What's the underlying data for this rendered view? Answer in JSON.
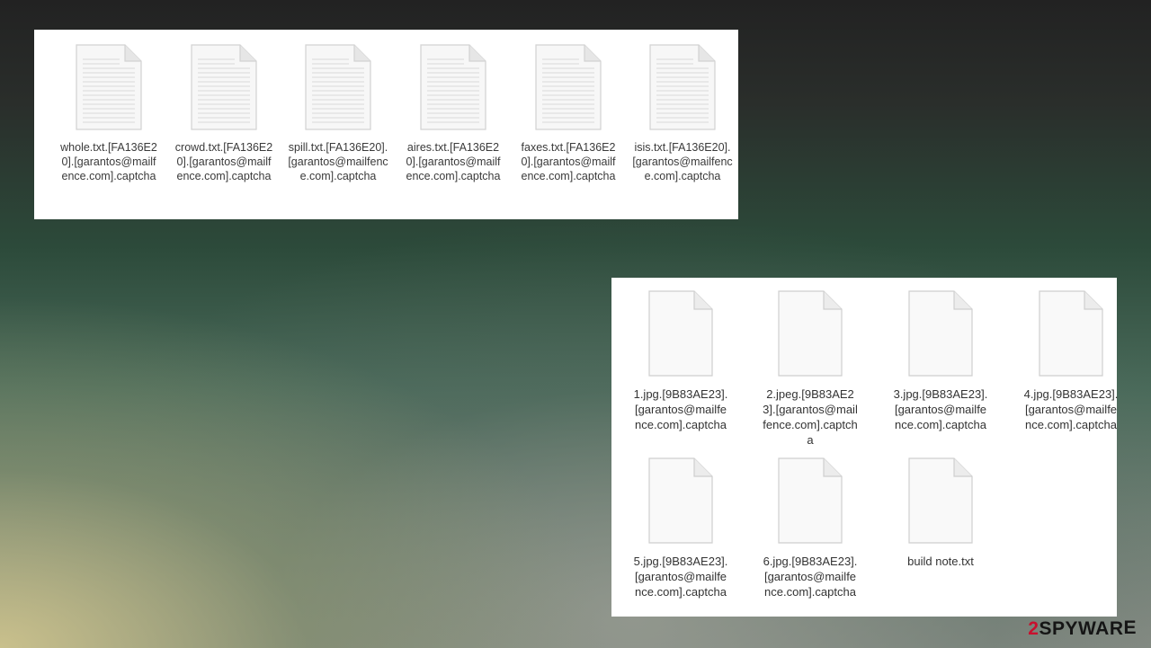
{
  "top_files": [
    {
      "name": "whole.txt.[FA136E20].[garantos@mailfence.com].captcha",
      "icon": "text-document-icon"
    },
    {
      "name": "crowd.txt.[FA136E20].[garantos@mailfence.com].captcha",
      "icon": "text-document-icon"
    },
    {
      "name": "spill.txt.[FA136E20].[garantos@mailfence.com].captcha",
      "icon": "text-document-icon"
    },
    {
      "name": "aires.txt.[FA136E20].[garantos@mailfence.com].captcha",
      "icon": "text-document-icon"
    },
    {
      "name": "faxes.txt.[FA136E20].[garantos@mailfence.com].captcha",
      "icon": "text-document-icon"
    },
    {
      "name": "isis.txt.[FA136E20].[garantos@mailfence.com].captcha",
      "icon": "text-document-icon"
    }
  ],
  "bottom_files": [
    {
      "name": "1.jpg.[9B83AE23].[garantos@mailfence.com].captcha",
      "icon": "blank-file-icon"
    },
    {
      "name": "2.jpeg.[9B83AE23].[garantos@mailfence.com].captcha",
      "icon": "blank-file-icon"
    },
    {
      "name": "3.jpg.[9B83AE23].[garantos@mailfence.com].captcha",
      "icon": "blank-file-icon"
    },
    {
      "name": "4.jpg.[9B83AE23].[garantos@mailfence.com].captcha",
      "icon": "blank-file-icon"
    },
    {
      "name": "5.jpg.[9B83AE23].[garantos@mailfence.com].captcha",
      "icon": "blank-file-icon"
    },
    {
      "name": "6.jpg.[9B83AE23].[garantos@mailfence.com].captcha",
      "icon": "blank-file-icon"
    },
    {
      "name": "build note.txt",
      "icon": "blank-file-icon"
    }
  ],
  "watermark": {
    "prefix": "2",
    "text": "SPYWAR",
    "suffix": "E"
  },
  "colors": {
    "watermark_red": "#c8102e",
    "panel_bg": "#ffffff",
    "label_text": "#333333"
  }
}
